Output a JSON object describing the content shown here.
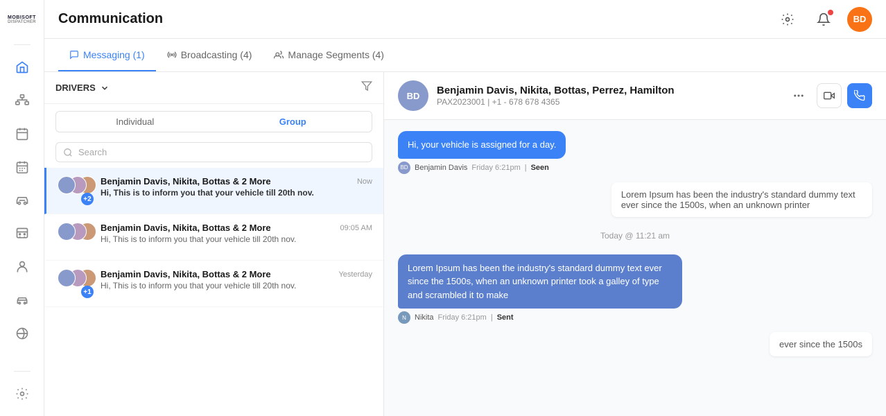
{
  "app": {
    "logo_line1": "MOBISOFT",
    "logo_line2": "DISPATCHER"
  },
  "header": {
    "title": "Communication",
    "avatar_initials": "BD"
  },
  "tabs": [
    {
      "id": "messaging",
      "label": "Messaging (1)",
      "active": true
    },
    {
      "id": "broadcasting",
      "label": "Broadcasting (4)",
      "active": false
    },
    {
      "id": "manage-segments",
      "label": "Manage Segments (4)",
      "active": false
    }
  ],
  "left_panel": {
    "section_label": "DRIVERS",
    "toggle": {
      "individual": "Individual",
      "group": "Group",
      "active": "Group"
    },
    "search_placeholder": "Search",
    "conversations": [
      {
        "id": 1,
        "name": "Benjamin Davis, Nikita, Bottas & 2 More",
        "preview": "Hi, This is to inform you that your vehicle till 20th nov.",
        "time": "Now",
        "badge": "+2",
        "active": true
      },
      {
        "id": 2,
        "name": "Benjamin Davis, Nikita, Bottas & 2 More",
        "preview": "Hi, This is to inform you that your vehicle till 20th nov.",
        "time": "09:05 AM",
        "badge": null,
        "active": false
      },
      {
        "id": 3,
        "name": "Benjamin Davis, Nikita, Bottas & 2 More",
        "preview": "Hi, This is to inform you that your vehicle till 20th nov.",
        "time": "Yesterday",
        "badge": "+1",
        "active": false
      }
    ]
  },
  "chat": {
    "header": {
      "name": "Benjamin Davis, Nikita, Bottas, Perrez, Hamilton",
      "pax_id": "PAX2023001",
      "phone": "+1 - 678 678 4365"
    },
    "messages": [
      {
        "id": 1,
        "type": "incoming_blue",
        "text": "Hi, your vehicle is assigned for a day.",
        "sender": "Benjamin Davis",
        "time": "Friday 6:21pm",
        "status": "Seen"
      },
      {
        "id": 2,
        "type": "outgoing_partial",
        "text": "Lorem Ipsum has been the industry's standard dummy text ever since the 1500s, when an unknown printer"
      },
      {
        "id": 3,
        "type": "date_divider",
        "text": "Today @ 11:21 am"
      },
      {
        "id": 4,
        "type": "incoming_blue_dark",
        "text": "Lorem Ipsum has been the industry's standard dummy text ever since the 1500s, when an unknown printer took a galley of type and scrambled it to make",
        "sender": "Nikita",
        "time": "Friday 6:21pm",
        "status": "Sent"
      },
      {
        "id": 5,
        "type": "outgoing_partial_bottom",
        "text": "ever since the 1500s"
      }
    ]
  },
  "sidebar": {
    "items": [
      {
        "id": "home",
        "icon": "home"
      },
      {
        "id": "org",
        "icon": "org"
      },
      {
        "id": "calendar",
        "icon": "calendar"
      },
      {
        "id": "schedule",
        "icon": "schedule"
      },
      {
        "id": "vehicle",
        "icon": "vehicle"
      },
      {
        "id": "bus",
        "icon": "bus"
      },
      {
        "id": "person",
        "icon": "person"
      },
      {
        "id": "car",
        "icon": "car"
      },
      {
        "id": "globe",
        "icon": "globe"
      }
    ]
  },
  "colors": {
    "active_blue": "#3b82f6",
    "bubble_blue": "#3b82f6",
    "bubble_blue_dark": "#5b7fcc"
  }
}
